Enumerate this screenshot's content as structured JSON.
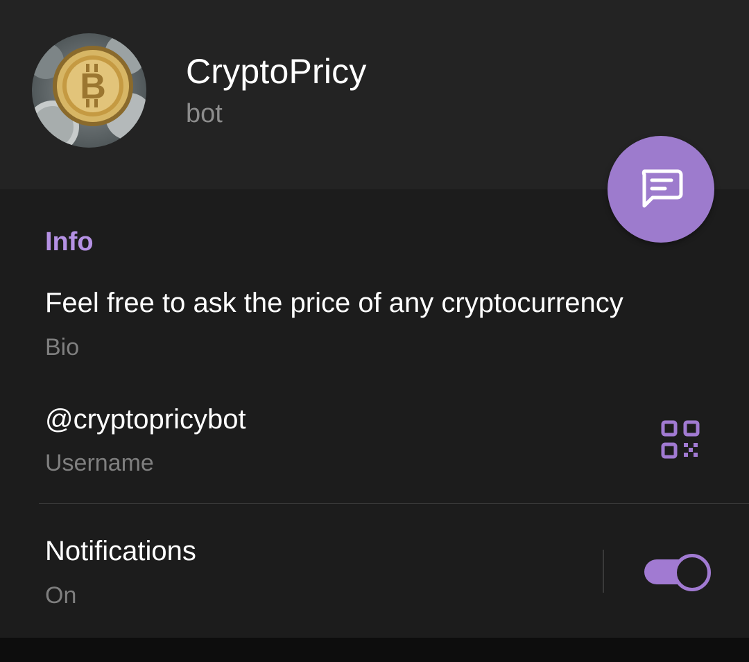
{
  "profile": {
    "name": "CryptoPricy",
    "status": "bot"
  },
  "info": {
    "section_title": "Info",
    "bio": {
      "value": "Feel free to ask the price of any cryptocurrency",
      "label": "Bio"
    },
    "username": {
      "value": "@cryptopricybot",
      "label": "Username"
    },
    "notifications": {
      "label": "Notifications",
      "value": "On",
      "enabled": true
    }
  },
  "icons": {
    "fab": "message-icon",
    "username_action": "qr-code-icon"
  },
  "colors": {
    "accent": "#9d7bcd",
    "section_title": "#b591e4",
    "header_bg": "#232323",
    "content_bg": "#1c1c1c"
  }
}
